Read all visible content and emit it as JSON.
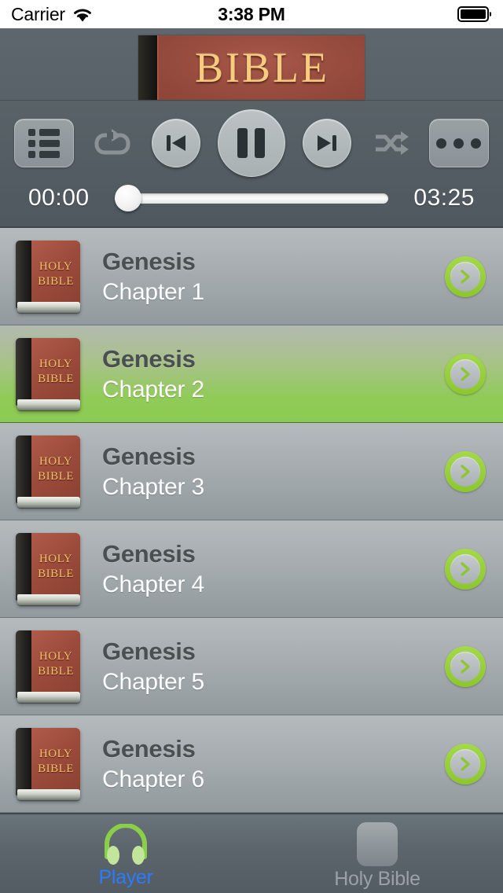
{
  "status_bar": {
    "carrier": "Carrier",
    "wifi_icon": "wifi-icon",
    "time": "3:38 PM",
    "battery_icon": "battery-full-icon"
  },
  "header": {
    "banner_text": "BIBLE",
    "banner_icon": "bible-book-banner"
  },
  "player": {
    "controls": [
      {
        "name": "playlist-button",
        "icon": "list-icon",
        "label": "Playlist"
      },
      {
        "name": "repeat-button",
        "icon": "repeat-icon",
        "label": "Repeat"
      },
      {
        "name": "previous-button",
        "icon": "previous-icon",
        "label": "Previous"
      },
      {
        "name": "play-pause-button",
        "icon": "pause-icon",
        "label": "Pause"
      },
      {
        "name": "next-button",
        "icon": "next-icon",
        "label": "Next"
      },
      {
        "name": "shuffle-button",
        "icon": "shuffle-icon",
        "label": "Shuffle"
      },
      {
        "name": "more-button",
        "icon": "ellipsis-icon",
        "label": "More"
      }
    ],
    "elapsed_time": "00:00",
    "total_time": "03:25",
    "progress_percent": 0
  },
  "list": {
    "rows": [
      {
        "book": "Genesis",
        "chapter": "Chapter 1",
        "selected": false,
        "thumb_line1": "HOLY",
        "thumb_line2": "BIBLE"
      },
      {
        "book": "Genesis",
        "chapter": "Chapter 2",
        "selected": true,
        "thumb_line1": "HOLY",
        "thumb_line2": "BIBLE"
      },
      {
        "book": "Genesis",
        "chapter": "Chapter 3",
        "selected": false,
        "thumb_line1": "HOLY",
        "thumb_line2": "BIBLE"
      },
      {
        "book": "Genesis",
        "chapter": "Chapter 4",
        "selected": false,
        "thumb_line1": "HOLY",
        "thumb_line2": "BIBLE"
      },
      {
        "book": "Genesis",
        "chapter": "Chapter 5",
        "selected": false,
        "thumb_line1": "HOLY",
        "thumb_line2": "BIBLE"
      },
      {
        "book": "Genesis",
        "chapter": "Chapter 6",
        "selected": false,
        "thumb_line1": "HOLY",
        "thumb_line2": "BIBLE"
      }
    ]
  },
  "tab_bar": {
    "tabs": [
      {
        "label": "Player",
        "icon": "headphones-icon",
        "active": true
      },
      {
        "label": "Holy Bible",
        "icon": "book-icon",
        "active": false
      }
    ]
  },
  "colors": {
    "header_bg": "#5a646a",
    "player_bg": "#535d63",
    "row_bg_top": "#b5babd",
    "row_bg_bottom": "#929a9e",
    "selected_green": "#8ccb52",
    "accent_green": "#8cc72f",
    "active_tab_blue": "#2b7bff",
    "book_red": "#9c4b3b",
    "book_gold": "#f4c267"
  }
}
